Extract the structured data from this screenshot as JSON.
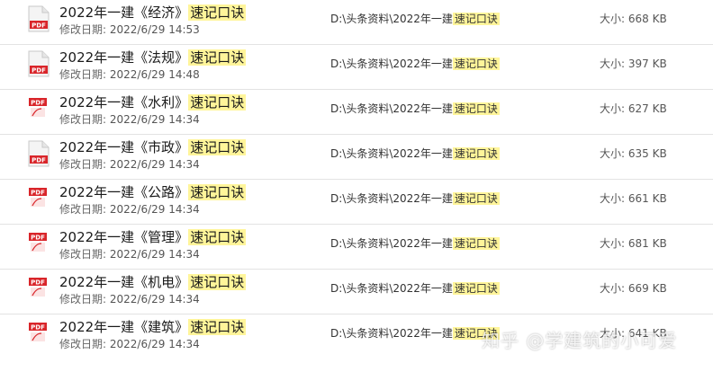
{
  "labels": {
    "modified": "修改日期:",
    "size": "大小:"
  },
  "highlight": "速记口诀",
  "rows": [
    {
      "title_prefix": "2022年一建《经济》",
      "modified": "2022/6/29 14:53",
      "path_prefix": "D:\\头条资料\\2022年一建",
      "size": "668 KB",
      "icon": "pdf-document-icon"
    },
    {
      "title_prefix": "2022年一建《法规》",
      "modified": "2022/6/29 14:48",
      "path_prefix": "D:\\头条资料\\2022年一建",
      "size": "397 KB",
      "icon": "pdf-document-icon"
    },
    {
      "title_prefix": "2022年一建《水利》",
      "modified": "2022/6/29 14:34",
      "path_prefix": "D:\\头条资料\\2022年一建",
      "size": "627 KB",
      "icon": "pdf-badge-icon"
    },
    {
      "title_prefix": "2022年一建《市政》",
      "modified": "2022/6/29 14:34",
      "path_prefix": "D:\\头条资料\\2022年一建",
      "size": "635 KB",
      "icon": "pdf-document-icon"
    },
    {
      "title_prefix": "2022年一建《公路》",
      "modified": "2022/6/29 14:34",
      "path_prefix": "D:\\头条资料\\2022年一建",
      "size": "661 KB",
      "icon": "pdf-badge-icon"
    },
    {
      "title_prefix": "2022年一建《管理》",
      "modified": "2022/6/29 14:34",
      "path_prefix": "D:\\头条资料\\2022年一建",
      "size": "681 KB",
      "icon": "pdf-badge-icon"
    },
    {
      "title_prefix": "2022年一建《机电》",
      "modified": "2022/6/29 14:34",
      "path_prefix": "D:\\头条资料\\2022年一建",
      "size": "669 KB",
      "icon": "pdf-badge-icon"
    },
    {
      "title_prefix": "2022年一建《建筑》",
      "modified": "2022/6/29 14:34",
      "path_prefix": "D:\\头条资料\\2022年一建",
      "size": "641 KB",
      "icon": "pdf-badge-icon"
    }
  ],
  "watermark": "知乎 @学建筑的小可爱",
  "colors": {
    "pdf_red": "#d9252a",
    "highlight": "#fff59a",
    "divider": "#e3e3e3"
  }
}
